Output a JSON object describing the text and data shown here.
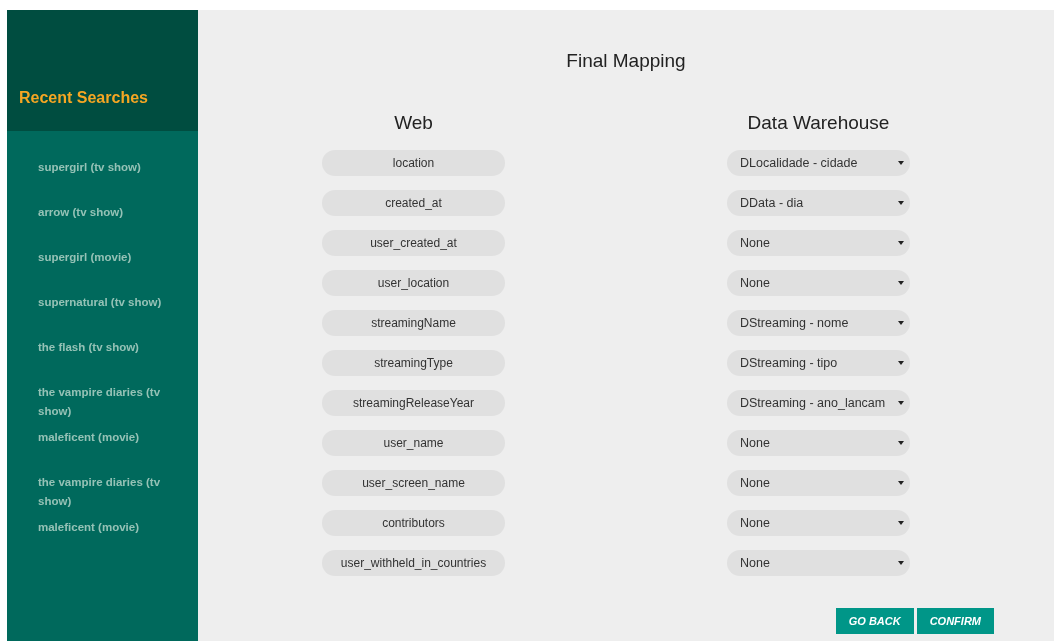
{
  "sidebar": {
    "title": "Recent Searches",
    "items": [
      {
        "label": "supergirl (tv show)"
      },
      {
        "label": "arrow (tv show)"
      },
      {
        "label": "supergirl (movie)"
      },
      {
        "label": "supernatural (tv show)"
      },
      {
        "label": "the flash (tv show)"
      },
      {
        "label": "the vampire diaries (tv show)"
      },
      {
        "label": "maleficent (movie)"
      },
      {
        "label": "the vampire diaries (tv show)"
      },
      {
        "label": "maleficent (movie)"
      }
    ]
  },
  "main": {
    "title": "Final Mapping",
    "columns": [
      "Web",
      "Data Warehouse"
    ],
    "rows": [
      {
        "web": "location",
        "warehouse": "DLocalidade - cidade"
      },
      {
        "web": "created_at",
        "warehouse": "DData - dia"
      },
      {
        "web": "user_created_at",
        "warehouse": "None"
      },
      {
        "web": "user_location",
        "warehouse": "None"
      },
      {
        "web": "streamingName",
        "warehouse": "DStreaming - nome"
      },
      {
        "web": "streamingType",
        "warehouse": "DStreaming - tipo"
      },
      {
        "web": "streamingReleaseYear",
        "warehouse": "DStreaming - ano_lancam"
      },
      {
        "web": "user_name",
        "warehouse": "None"
      },
      {
        "web": "user_screen_name",
        "warehouse": "None"
      },
      {
        "web": "contributors",
        "warehouse": "None"
      },
      {
        "web": "user_withheld_in_countries",
        "warehouse": "None"
      }
    ],
    "buttons": [
      "GO BACK",
      "CONFIRM"
    ]
  }
}
